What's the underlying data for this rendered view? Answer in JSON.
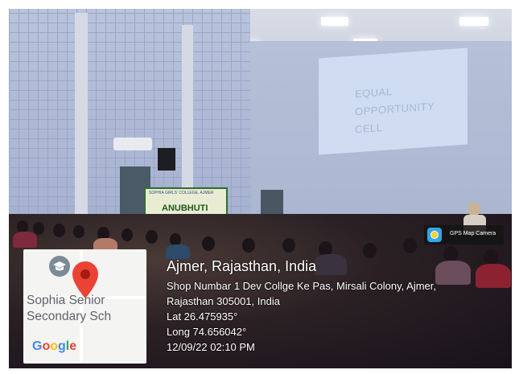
{
  "scene": {
    "screen_text": [
      "EQUAL",
      "OPPORTUNITY",
      "CELL"
    ],
    "banner": {
      "college": "SOPHIA GIRLS' COLLEGE, AJMER",
      "title": "ANUBHUTI"
    }
  },
  "map": {
    "place_label": [
      "Sophia Senior",
      "Secondary Sch"
    ],
    "google_letters": [
      {
        "ch": "G",
        "color": "#4285F4"
      },
      {
        "ch": "o",
        "color": "#EA4335"
      },
      {
        "ch": "o",
        "color": "#FBBC05"
      },
      {
        "ch": "g",
        "color": "#4285F4"
      },
      {
        "ch": "l",
        "color": "#34A853"
      },
      {
        "ch": "e",
        "color": "#EA4335"
      }
    ],
    "pin_color": "#EA4335",
    "icon": "graduation-cap-icon"
  },
  "location": {
    "title": "Ajmer, Rajasthan, India",
    "address_line1": "Shop Numbar 1 Dev Collge Ke Pas, Mirsali Colony, Ajmer,",
    "address_line2": "Rajasthan 305001, India",
    "latitude": "Lat 26.475935°",
    "longitude": "Long 74.656042°",
    "datetime": "12/09/22 02:10 PM"
  },
  "badge": {
    "label": "GPS Map Camera",
    "icon": "gps-map-camera-icon"
  }
}
